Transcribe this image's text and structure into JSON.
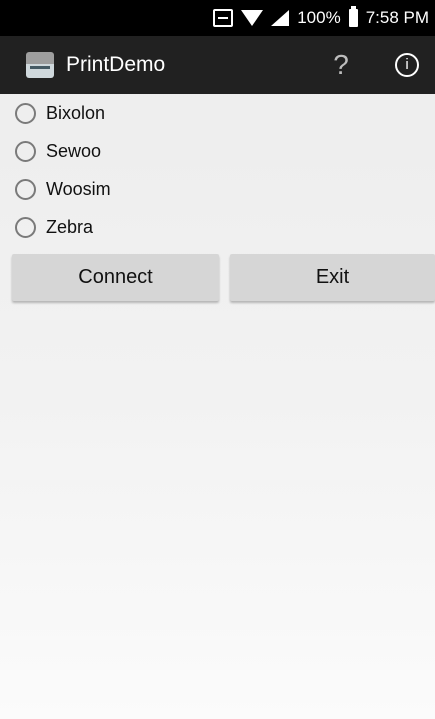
{
  "status_bar": {
    "battery": "100%",
    "time": "7:58 PM",
    "icons": [
      "barcode-scanner-icon",
      "wifi-icon",
      "cell-signal-icon",
      "battery-icon"
    ]
  },
  "app_bar": {
    "title": "PrintDemo",
    "app_icon": "printer-icon",
    "help_label": "?",
    "info_label": "i"
  },
  "printers": [
    {
      "label": "Bixolon",
      "selected": false
    },
    {
      "label": "Sewoo",
      "selected": false
    },
    {
      "label": "Woosim",
      "selected": false
    },
    {
      "label": "Zebra",
      "selected": false
    }
  ],
  "buttons": {
    "connect": "Connect",
    "exit": "Exit"
  }
}
